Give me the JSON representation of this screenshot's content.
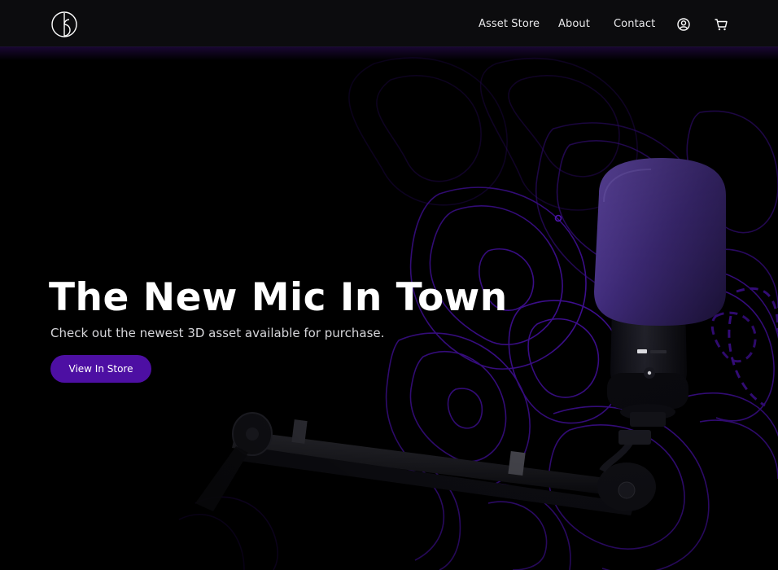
{
  "nav": {
    "logo_icon": "circle-b-logo-icon",
    "links": [
      "Asset Store",
      "About",
      "Contact"
    ],
    "account_icon": "user-circle-icon",
    "cart_icon": "shopping-cart-icon"
  },
  "hero": {
    "title": "The New Mic In Town",
    "subtitle": "Check out the newest 3D asset available for purchase.",
    "cta_label": "View In Store",
    "art": "microphone-on-boom-arm-with-topographic-lines"
  },
  "colors": {
    "background": "#000000",
    "navbar": "#0c0c0e",
    "accent": "#4d0fa3",
    "contour": "#5a18c9"
  }
}
